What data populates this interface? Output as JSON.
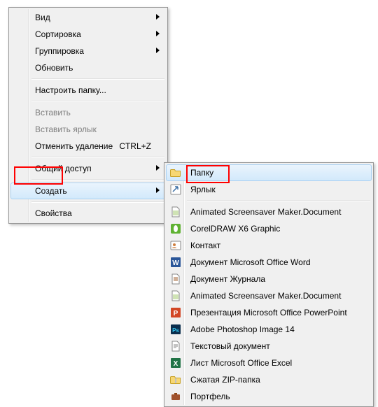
{
  "main_menu": {
    "view": "Вид",
    "sort": "Сортировка",
    "group": "Группировка",
    "refresh": "Обновить",
    "customize_folder": "Настроить папку...",
    "paste": "Вставить",
    "paste_shortcut": "Вставить ярлык",
    "undo_delete": "Отменить удаление",
    "undo_delete_shortcut": "CTRL+Z",
    "share": "Общий доступ",
    "create": "Создать",
    "properties": "Свойства"
  },
  "sub_menu": {
    "folder": "Папку",
    "shortcut": "Ярлык",
    "asm_doc": "Animated Screensaver Maker.Document",
    "corel": "CorelDRAW X6 Graphic",
    "contact": "Контакт",
    "word": "Документ Microsoft Office Word",
    "journal": "Документ Журнала",
    "asm_doc2": "Animated Screensaver Maker.Document",
    "pptx": "Презентация Microsoft Office PowerPoint",
    "psd": "Adobe Photoshop Image 14",
    "txt": "Текстовый документ",
    "xlsx": "Лист Microsoft Office Excel",
    "zip": "Сжатая ZIP-папка",
    "briefcase": "Портфель"
  }
}
